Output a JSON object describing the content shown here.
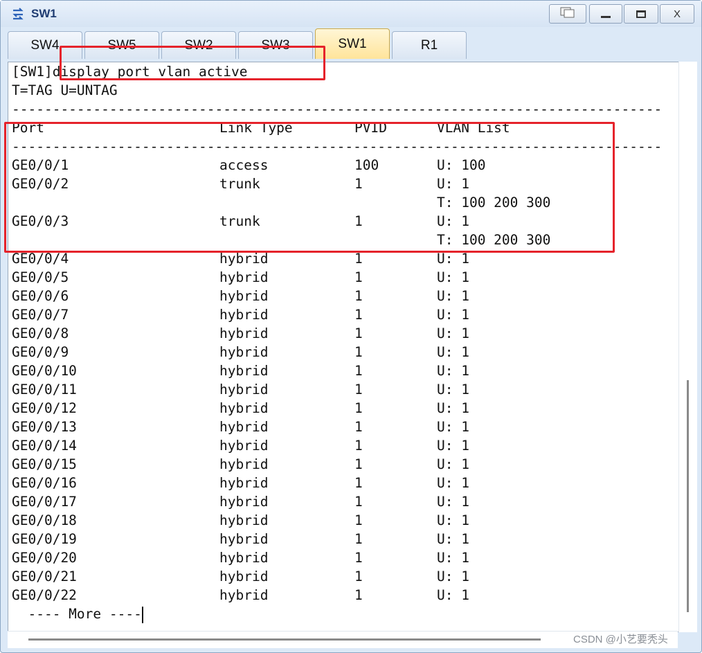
{
  "window": {
    "title": "SW1",
    "controls": {
      "restore": "▢",
      "minimize": "—",
      "maximize": "▭",
      "close": "X"
    }
  },
  "tabs": [
    {
      "label": "SW4",
      "active": false
    },
    {
      "label": "SW5",
      "active": false
    },
    {
      "label": "SW2",
      "active": false
    },
    {
      "label": "SW3",
      "active": false
    },
    {
      "label": "SW1",
      "active": true
    },
    {
      "label": "R1",
      "active": false
    }
  ],
  "terminal": {
    "prompt": "[SW1]",
    "command": "display port vlan active",
    "legend": "T=TAG U=UNTAG",
    "separator": "--------------------------------------------------------------------------------",
    "headers": {
      "port": "Port",
      "link_type": "Link Type",
      "pvid": "PVID",
      "vlan_list": "VLAN List"
    },
    "rows": [
      {
        "port": "GE0/0/1",
        "type": "access",
        "pvid": "100",
        "vlan": "U: 100"
      },
      {
        "port": "GE0/0/2",
        "type": "trunk",
        "pvid": "1",
        "vlan": "U: 1"
      },
      {
        "port": "",
        "type": "",
        "pvid": "",
        "vlan": "T: 100 200 300"
      },
      {
        "port": "GE0/0/3",
        "type": "trunk",
        "pvid": "1",
        "vlan": "U: 1"
      },
      {
        "port": "",
        "type": "",
        "pvid": "",
        "vlan": "T: 100 200 300"
      },
      {
        "port": "GE0/0/4",
        "type": "hybrid",
        "pvid": "1",
        "vlan": "U: 1"
      },
      {
        "port": "GE0/0/5",
        "type": "hybrid",
        "pvid": "1",
        "vlan": "U: 1"
      },
      {
        "port": "GE0/0/6",
        "type": "hybrid",
        "pvid": "1",
        "vlan": "U: 1"
      },
      {
        "port": "GE0/0/7",
        "type": "hybrid",
        "pvid": "1",
        "vlan": "U: 1"
      },
      {
        "port": "GE0/0/8",
        "type": "hybrid",
        "pvid": "1",
        "vlan": "U: 1"
      },
      {
        "port": "GE0/0/9",
        "type": "hybrid",
        "pvid": "1",
        "vlan": "U: 1"
      },
      {
        "port": "GE0/0/10",
        "type": "hybrid",
        "pvid": "1",
        "vlan": "U: 1"
      },
      {
        "port": "GE0/0/11",
        "type": "hybrid",
        "pvid": "1",
        "vlan": "U: 1"
      },
      {
        "port": "GE0/0/12",
        "type": "hybrid",
        "pvid": "1",
        "vlan": "U: 1"
      },
      {
        "port": "GE0/0/13",
        "type": "hybrid",
        "pvid": "1",
        "vlan": "U: 1"
      },
      {
        "port": "GE0/0/14",
        "type": "hybrid",
        "pvid": "1",
        "vlan": "U: 1"
      },
      {
        "port": "GE0/0/15",
        "type": "hybrid",
        "pvid": "1",
        "vlan": "U: 1"
      },
      {
        "port": "GE0/0/16",
        "type": "hybrid",
        "pvid": "1",
        "vlan": "U: 1"
      },
      {
        "port": "GE0/0/17",
        "type": "hybrid",
        "pvid": "1",
        "vlan": "U: 1"
      },
      {
        "port": "GE0/0/18",
        "type": "hybrid",
        "pvid": "1",
        "vlan": "U: 1"
      },
      {
        "port": "GE0/0/19",
        "type": "hybrid",
        "pvid": "1",
        "vlan": "U: 1"
      },
      {
        "port": "GE0/0/20",
        "type": "hybrid",
        "pvid": "1",
        "vlan": "U: 1"
      },
      {
        "port": "GE0/0/21",
        "type": "hybrid",
        "pvid": "1",
        "vlan": "U: 1"
      },
      {
        "port": "GE0/0/22",
        "type": "hybrid",
        "pvid": "1",
        "vlan": "U: 1"
      }
    ],
    "more_prompt": "  ---- More ----"
  },
  "watermark": "CSDN @小艺要秃头",
  "colors": {
    "highlight": "#e5232b",
    "active_tab": "#ffe49a",
    "title": "#1f3c72"
  }
}
